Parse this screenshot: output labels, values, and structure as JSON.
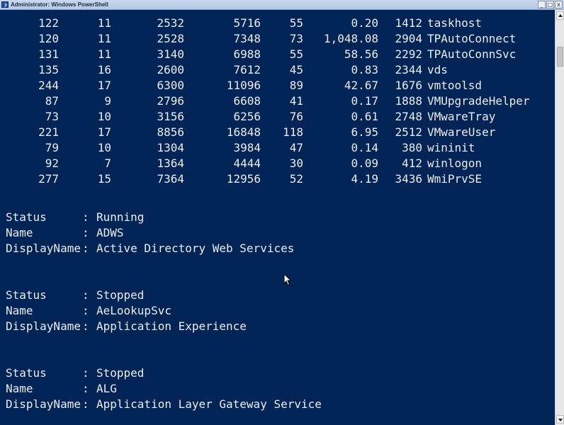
{
  "window": {
    "title": "Administrator: Windows PowerShell",
    "controls": {
      "minimize": "_",
      "maximize": "□",
      "close": "x"
    }
  },
  "process_rows": [
    [
      "122",
      "11",
      "2532",
      "5716",
      "55",
      "0.20",
      "1412",
      "taskhost"
    ],
    [
      "120",
      "11",
      "2528",
      "7348",
      "73",
      "1,048.08",
      "2904",
      "TPAutoConnect"
    ],
    [
      "131",
      "11",
      "3140",
      "6988",
      "55",
      "58.56",
      "2292",
      "TPAutoConnSvc"
    ],
    [
      "135",
      "16",
      "2600",
      "7612",
      "45",
      "0.83",
      "2344",
      "vds"
    ],
    [
      "244",
      "17",
      "6300",
      "11096",
      "89",
      "42.67",
      "1676",
      "vmtoolsd"
    ],
    [
      "87",
      "9",
      "2796",
      "6608",
      "41",
      "0.17",
      "1888",
      "VMUpgradeHelper"
    ],
    [
      "73",
      "10",
      "3156",
      "6256",
      "76",
      "0.61",
      "2748",
      "VMwareTray"
    ],
    [
      "221",
      "17",
      "8856",
      "16848",
      "118",
      "6.95",
      "2512",
      "VMwareUser"
    ],
    [
      "79",
      "10",
      "1304",
      "3984",
      "47",
      "0.14",
      "380",
      "wininit"
    ],
    [
      "92",
      "7",
      "1364",
      "4444",
      "30",
      "0.09",
      "412",
      "winlogon"
    ],
    [
      "277",
      "15",
      "7364",
      "12956",
      "52",
      "4.19",
      "3436",
      "WmiPrvSE"
    ]
  ],
  "services": [
    {
      "status_key": "Status",
      "status": "Running",
      "name_key": "Name",
      "name": "ADWS",
      "display_key": "DisplayName",
      "display": "Active Directory Web Services"
    },
    {
      "status_key": "Status",
      "status": "Stopped",
      "name_key": "Name",
      "name": "AeLookupSvc",
      "display_key": "DisplayName",
      "display": "Application Experience"
    },
    {
      "status_key": "Status",
      "status": "Stopped",
      "name_key": "Name",
      "name": "ALG",
      "display_key": "DisplayName",
      "display": "Application Layer Gateway Service"
    }
  ],
  "separator": ":",
  "colors": {
    "console_background": "#012456",
    "console_text": "#eeedf0"
  }
}
